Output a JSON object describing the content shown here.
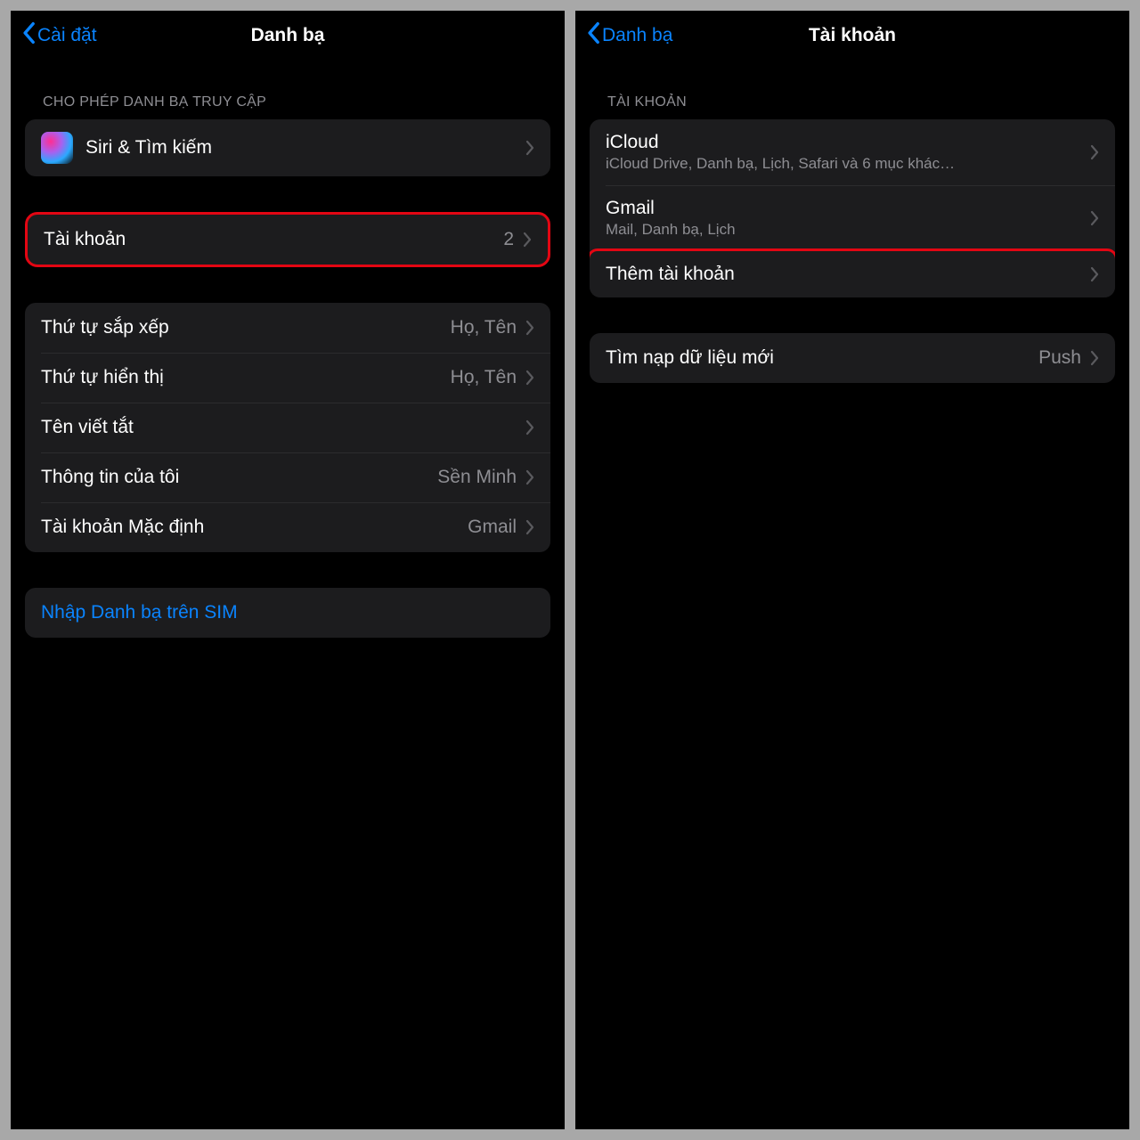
{
  "left": {
    "back": "Cài đặt",
    "title": "Danh bạ",
    "sectionHeader": "CHO PHÉP DANH BẠ TRUY CẬP",
    "siri": "Siri & Tìm kiếm",
    "accounts": {
      "label": "Tài khoản",
      "value": "2"
    },
    "prefs": {
      "sort": {
        "label": "Thứ tự sắp xếp",
        "value": "Họ, Tên"
      },
      "display": {
        "label": "Thứ tự hiển thị",
        "value": "Họ, Tên"
      },
      "shortname": {
        "label": "Tên viết tắt"
      },
      "myinfo": {
        "label": "Thông tin của tôi",
        "value": "Sền Minh"
      },
      "defaultAcc": {
        "label": "Tài khoản Mặc định",
        "value": "Gmail"
      }
    },
    "simImport": "Nhập Danh bạ trên SIM"
  },
  "right": {
    "back": "Danh bạ",
    "title": "Tài khoản",
    "sectionHeader": "TÀI KHOẢN",
    "icloud": {
      "label": "iCloud",
      "sub": "iCloud Drive, Danh bạ, Lịch, Safari và 6 mục khác…"
    },
    "gmail": {
      "label": "Gmail",
      "sub": "Mail, Danh bạ, Lịch"
    },
    "add": "Thêm tài khoản",
    "fetch": {
      "label": "Tìm nạp dữ liệu mới",
      "value": "Push"
    }
  }
}
